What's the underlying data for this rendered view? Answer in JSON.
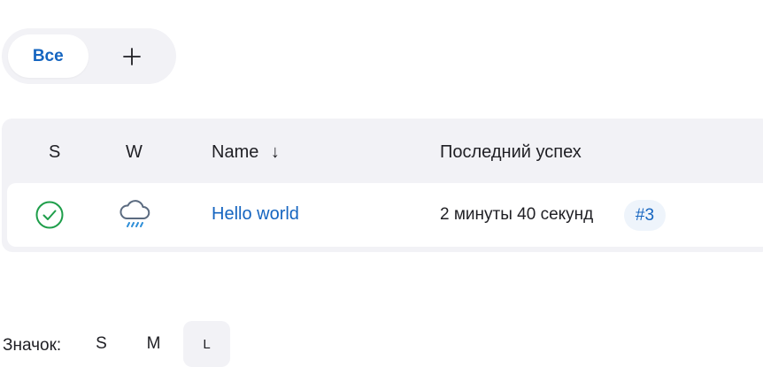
{
  "tabs": {
    "all_label": "Все",
    "add_icon": "plus-icon"
  },
  "table": {
    "headers": {
      "status": "S",
      "weather": "W",
      "name": "Name",
      "sort_indicator": "↓",
      "last_success": "Последний успех"
    },
    "rows": [
      {
        "status_icon": "success-check-icon",
        "weather_icon": "rain-cloud-icon",
        "name": "Hello world",
        "last_success": "2 минуты 40 секунд",
        "build": "#3"
      }
    ]
  },
  "icon_size": {
    "label": "Значок:",
    "options": [
      "S",
      "M",
      "L"
    ],
    "selected": "L"
  },
  "colors": {
    "accent": "#1565c0",
    "success": "#1e9e4a",
    "weather": "#5b6b80",
    "panel": "#f2f2f6"
  }
}
